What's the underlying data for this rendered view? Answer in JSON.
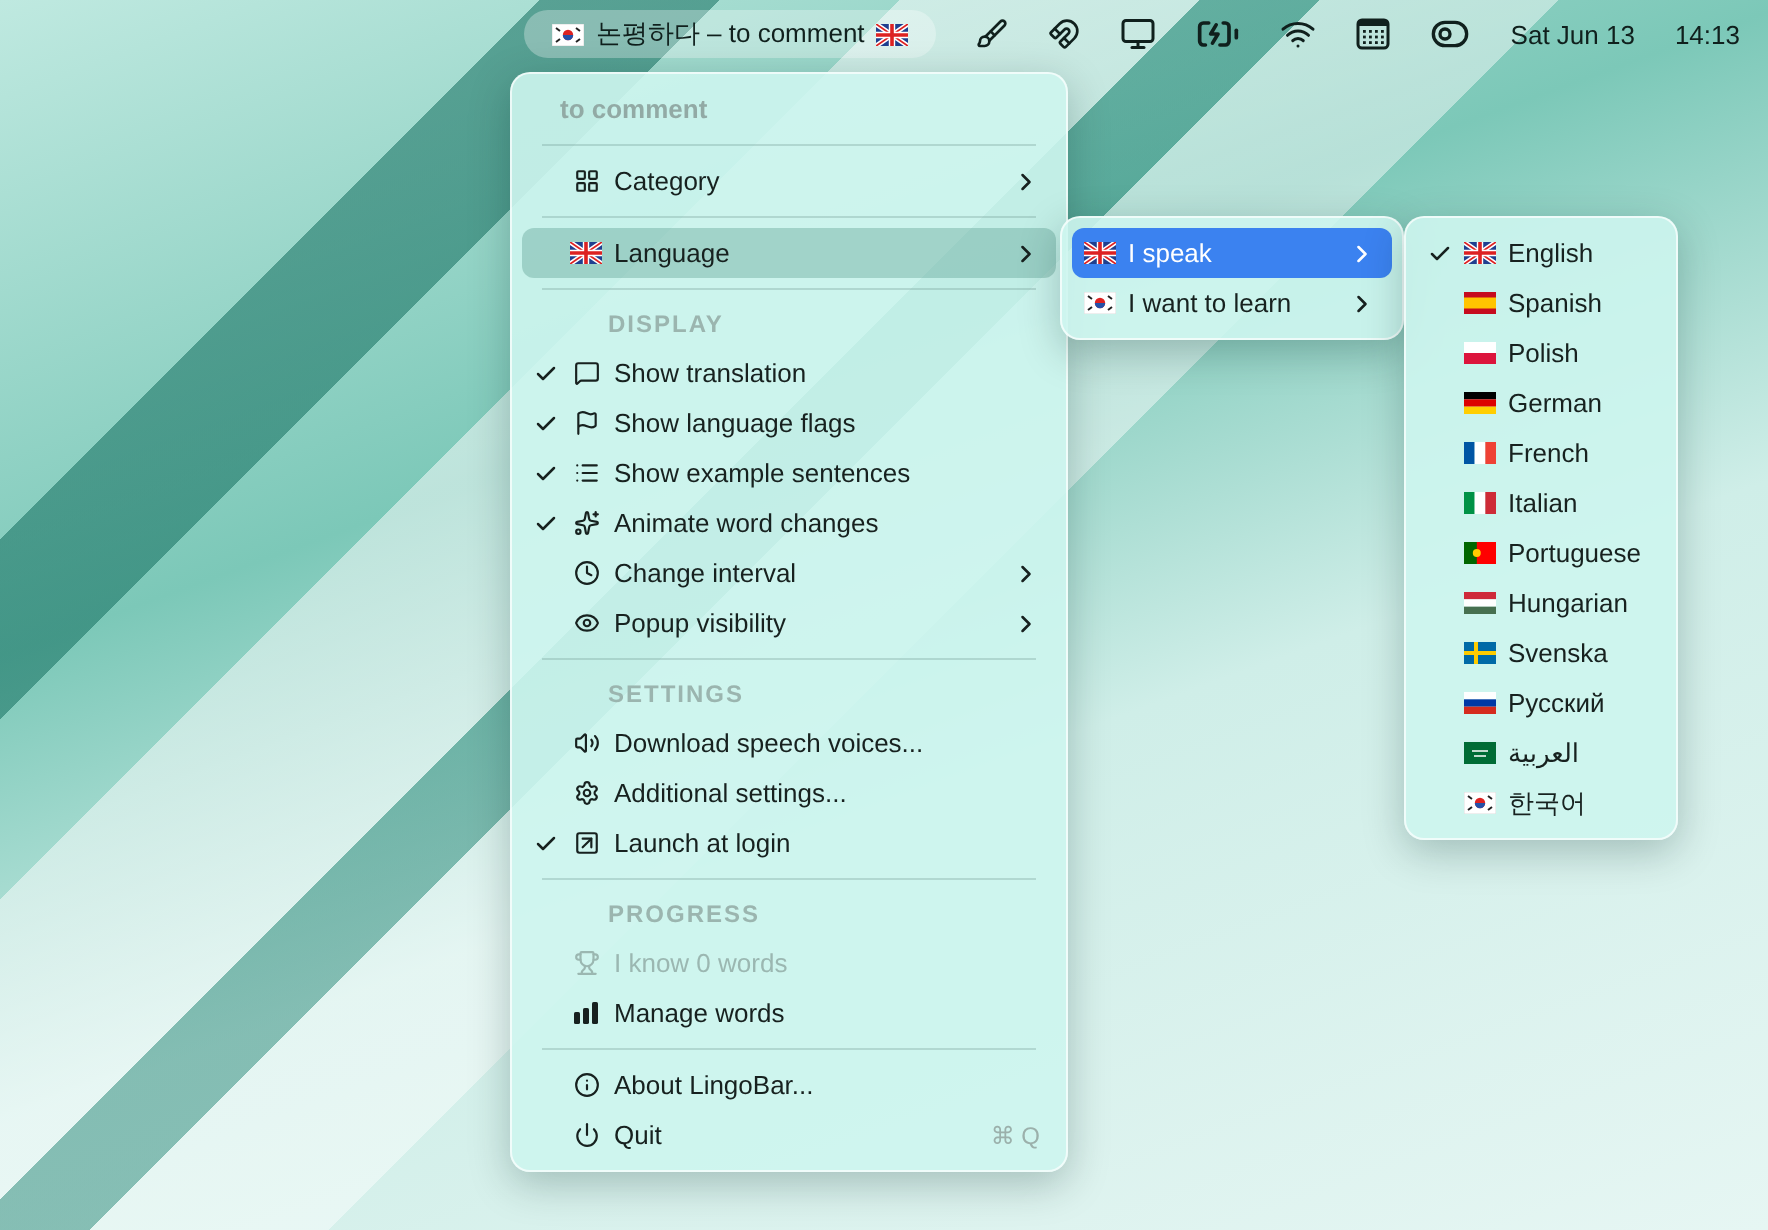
{
  "menu_bar": {
    "app_title": "논평하다 – to comment",
    "date": "Sat Jun 13",
    "time": "14:13"
  },
  "main_menu": {
    "items": [
      {
        "kind": "title",
        "label": "to comment"
      },
      {
        "kind": "separator"
      },
      {
        "kind": "item",
        "label": "Category",
        "checked": false,
        "selected": false,
        "disabled": false,
        "submenu": true
      },
      {
        "kind": "separator"
      },
      {
        "kind": "item",
        "label": "Language",
        "checked": false,
        "selected": true,
        "disabled": false,
        "submenu": true
      },
      {
        "kind": "separator"
      },
      {
        "kind": "heading",
        "label": "DISPLAY"
      },
      {
        "kind": "item",
        "label": "Show translation",
        "checked": true,
        "selected": false,
        "disabled": false,
        "submenu": false
      },
      {
        "kind": "item",
        "label": "Show language flags",
        "checked": true,
        "selected": false,
        "disabled": false,
        "submenu": false
      },
      {
        "kind": "item",
        "label": "Show example sentences",
        "checked": true,
        "selected": false,
        "disabled": false,
        "submenu": false
      },
      {
        "kind": "item",
        "label": "Animate word changes",
        "checked": true,
        "selected": false,
        "disabled": false,
        "submenu": false
      },
      {
        "kind": "item",
        "label": "Change interval",
        "checked": false,
        "selected": false,
        "disabled": false,
        "submenu": true
      },
      {
        "kind": "item",
        "label": "Popup visibility",
        "checked": false,
        "selected": false,
        "disabled": false,
        "submenu": true
      },
      {
        "kind": "separator"
      },
      {
        "kind": "heading",
        "label": "SETTINGS"
      },
      {
        "kind": "item",
        "label": "Download speech voices...",
        "checked": false,
        "selected": false,
        "disabled": false,
        "submenu": false
      },
      {
        "kind": "item",
        "label": "Additional settings...",
        "checked": false,
        "selected": false,
        "disabled": false,
        "submenu": false
      },
      {
        "kind": "item",
        "label": "Launch at login",
        "checked": true,
        "selected": false,
        "disabled": false,
        "submenu": false
      },
      {
        "kind": "separator"
      },
      {
        "kind": "heading",
        "label": "PROGRESS"
      },
      {
        "kind": "item",
        "label": "I know 0 words",
        "checked": false,
        "selected": false,
        "disabled": true,
        "submenu": false
      },
      {
        "kind": "item",
        "label": "Manage words",
        "checked": false,
        "selected": false,
        "disabled": false,
        "submenu": false
      },
      {
        "kind": "separator"
      },
      {
        "kind": "item",
        "label": "About LingoBar...",
        "checked": false,
        "selected": false,
        "disabled": false,
        "submenu": false
      },
      {
        "kind": "item",
        "label": "Quit",
        "checked": false,
        "selected": false,
        "disabled": false,
        "submenu": false,
        "shortcut": "⌘ Q"
      }
    ]
  },
  "language_menu": {
    "items": [
      {
        "label": "I speak",
        "selected": true
      },
      {
        "label": "I want to learn",
        "selected": false
      }
    ]
  },
  "speak_menu": {
    "items": [
      {
        "label": "English",
        "checked": true
      },
      {
        "label": "Spanish",
        "checked": false
      },
      {
        "label": "Polish",
        "checked": false
      },
      {
        "label": "German",
        "checked": false
      },
      {
        "label": "French",
        "checked": false
      },
      {
        "label": "Italian",
        "checked": false
      },
      {
        "label": "Portuguese",
        "checked": false
      },
      {
        "label": "Hungarian",
        "checked": false
      },
      {
        "label": "Svenska",
        "checked": false
      },
      {
        "label": "Русский",
        "checked": false
      },
      {
        "label": "العربية",
        "checked": false
      },
      {
        "label": "한국어",
        "checked": false
      }
    ]
  }
}
